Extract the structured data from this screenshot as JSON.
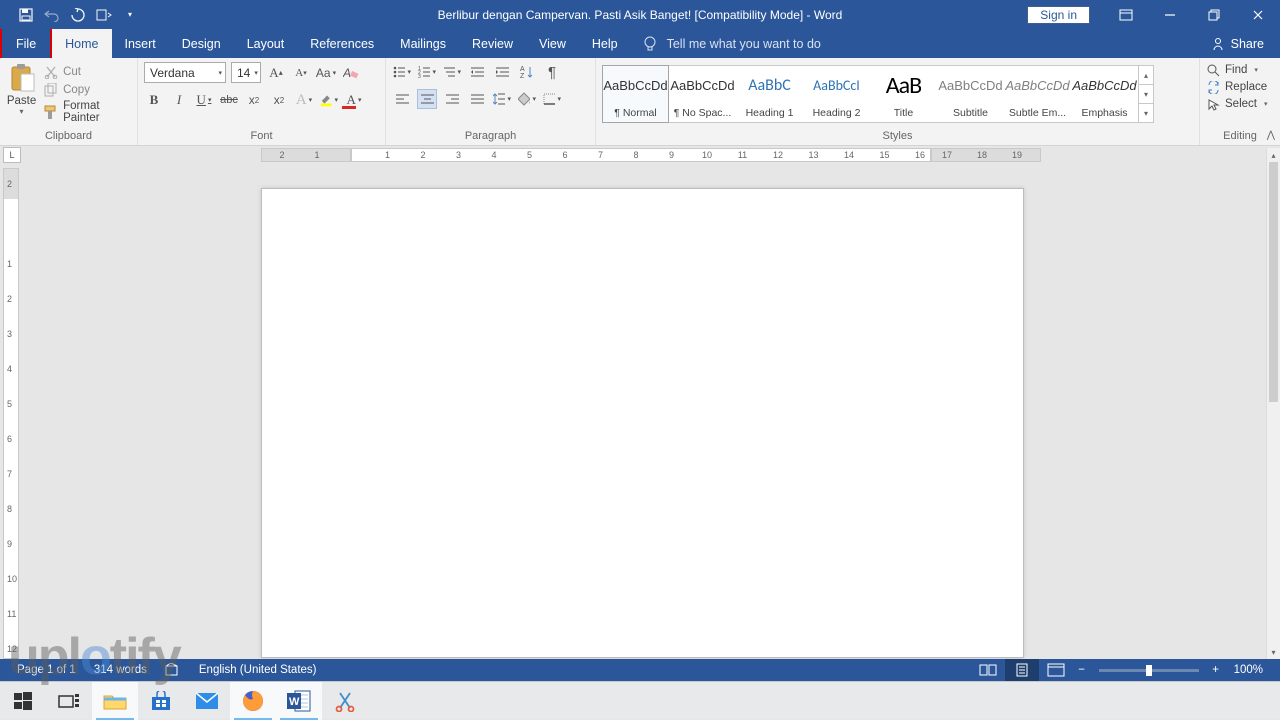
{
  "title": "Berlibur dengan Campervan. Pasti Asik Banget! [Compatibility Mode]  -  Word",
  "signin": "Sign in",
  "tabs": {
    "file": "File",
    "home": "Home",
    "insert": "Insert",
    "design": "Design",
    "layout": "Layout",
    "references": "References",
    "mailings": "Mailings",
    "review": "Review",
    "view": "View",
    "help": "Help",
    "tellme": "Tell me what you want to do",
    "share": "Share"
  },
  "clipboard": {
    "paste": "Paste",
    "cut": "Cut",
    "copy": "Copy",
    "format_painter": "Format Painter",
    "group_label": "Clipboard"
  },
  "font": {
    "name": "Verdana",
    "size": "14",
    "group_label": "Font"
  },
  "paragraph": {
    "group_label": "Paragraph"
  },
  "styles": {
    "group_label": "Styles",
    "items": [
      {
        "preview": "AaBbCcDd",
        "name": "¶ Normal",
        "cls": ""
      },
      {
        "preview": "AaBbCcDd",
        "name": "¶ No Spac...",
        "cls": ""
      },
      {
        "preview": "AaBbC",
        "name": "Heading 1",
        "cls": "h1"
      },
      {
        "preview": "AaBbCcI",
        "name": "Heading 2",
        "cls": "h2"
      },
      {
        "preview": "AaB",
        "name": "Title",
        "cls": "title"
      },
      {
        "preview": "AaBbCcDd",
        "name": "Subtitle",
        "cls": "sub"
      },
      {
        "preview": "AaBbCcDd",
        "name": "Subtle Em...",
        "cls": "sub em"
      },
      {
        "preview": "AaBbCcDd",
        "name": "Emphasis",
        "cls": "em"
      }
    ]
  },
  "editing": {
    "find": "Find",
    "replace": "Replace",
    "select": "Select",
    "group_label": "Editing"
  },
  "status": {
    "page": "Page 1 of 1",
    "words": "314 words",
    "lang": "English (United States)",
    "zoom": "100%"
  },
  "watermark": {
    "p1": "upl",
    "p2": "tify"
  }
}
